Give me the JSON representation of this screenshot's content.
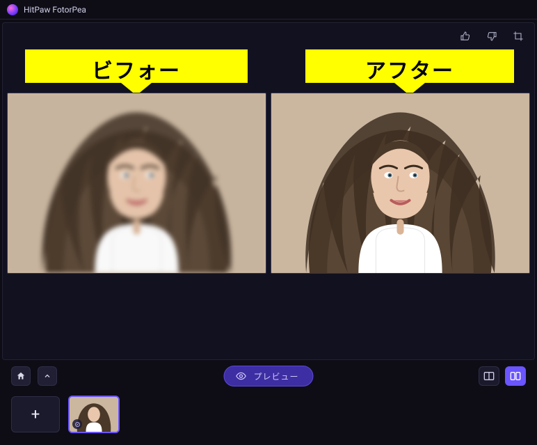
{
  "app": {
    "title": "HitPaw FotorPea"
  },
  "labels": {
    "before": "ビフォー",
    "after": "アフター"
  },
  "toolbar": {
    "preview_label": "プレビュー",
    "add_label": "+"
  },
  "icons": {
    "thumb_up": "thumb-up-icon",
    "thumb_down": "thumb-down-icon",
    "crop": "crop-icon",
    "home": "home-icon",
    "chevron_up": "chevron-up-icon",
    "eye": "eye-icon",
    "compare_single": "single-view-icon",
    "compare_split": "split-view-icon",
    "zoom_in": "+",
    "zoom_out": "−",
    "enhance_badge": "enhance-badge-icon"
  },
  "colors": {
    "accent": "#6a55ff",
    "highlight": "#ffff00",
    "panel": "#1b1a2c",
    "canvas_bg": "#cbb7a0"
  }
}
